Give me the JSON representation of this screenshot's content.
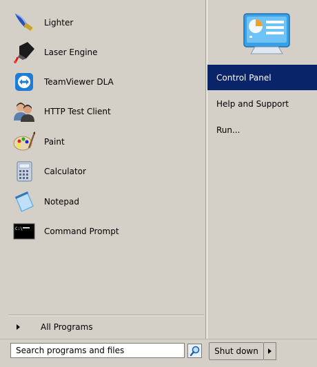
{
  "programs": [
    {
      "label": "Lighter",
      "icon": "lighter-icon"
    },
    {
      "label": "Laser Engine",
      "icon": "laser-engine-icon"
    },
    {
      "label": "TeamViewer DLA",
      "icon": "teamviewer-icon"
    },
    {
      "label": "HTTP Test Client",
      "icon": "http-test-client-icon"
    },
    {
      "label": "Paint",
      "icon": "paint-palette-icon"
    },
    {
      "label": "Calculator",
      "icon": "calculator-icon"
    },
    {
      "label": "Notepad",
      "icon": "notepad-icon"
    },
    {
      "label": "Command Prompt",
      "icon": "command-prompt-icon"
    }
  ],
  "all_programs": {
    "label": "All Programs"
  },
  "search": {
    "placeholder": "Search programs and files",
    "value": "Search programs and files"
  },
  "right_panel": {
    "icon": "control-panel-icon",
    "items": [
      {
        "label": "Control Panel",
        "selected": true
      },
      {
        "label": "Help and Support",
        "selected": false
      },
      {
        "label": "Run...",
        "selected": false
      }
    ]
  },
  "shutdown": {
    "label": "Shut down"
  },
  "colors": {
    "selection": "#0a246a",
    "menu_background": "#d4d0c8"
  }
}
